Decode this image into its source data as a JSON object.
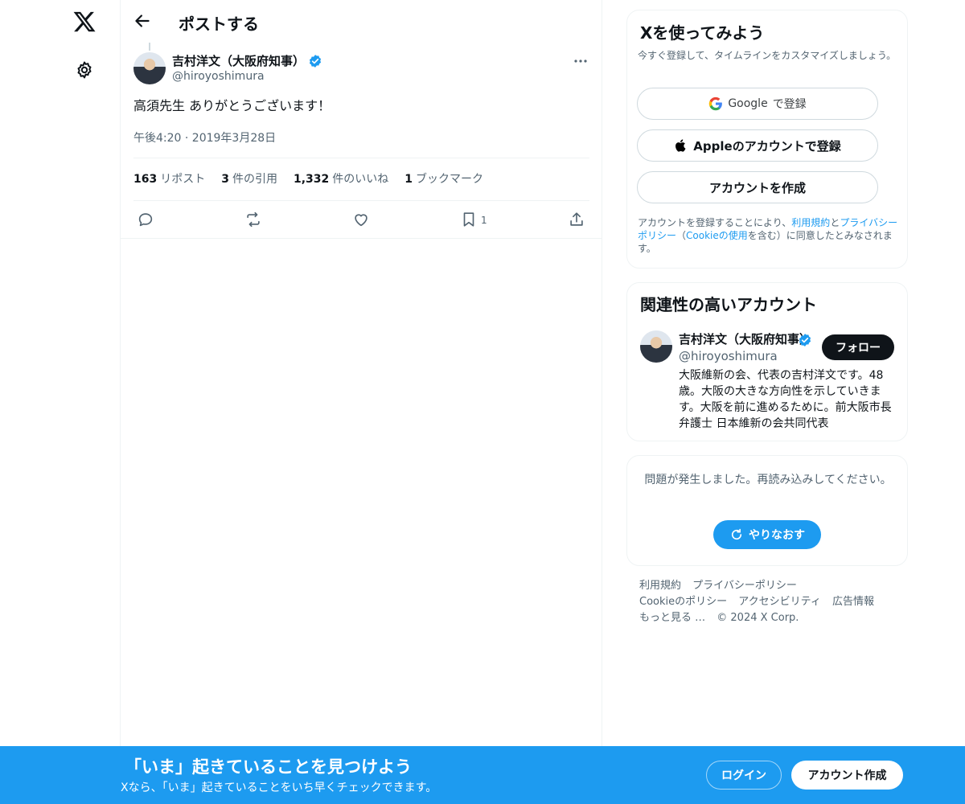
{
  "header": {
    "title": "ポストする"
  },
  "post": {
    "author_name": "吉村洋文（大阪府知事）",
    "author_handle": "@hiroyoshimura",
    "text": "高須先生 ありがとうございます！",
    "timestamp": "午後4:20 · 2019年3月28日",
    "stats": [
      {
        "count": "163",
        "label": "リポスト"
      },
      {
        "count": "3",
        "label": "件の引用"
      },
      {
        "count": "1,332",
        "label": "件のいいね"
      },
      {
        "count": "1",
        "label": "ブックマーク"
      }
    ],
    "bookmark_count": "1"
  },
  "signup_card": {
    "title": "Xを使ってみよう",
    "subtitle": "今すぐ登録して、タイムラインをカスタマイズしましょう。",
    "google_label": "Google",
    "google_suffix": "で登録",
    "apple_label": "Appleのアカウントで登録",
    "create_label": "アカウントを作成",
    "legal_prefix": "アカウントを登録することにより、",
    "legal_terms": "利用規約",
    "legal_and": "と",
    "legal_privacy": "プライバシーポリシー",
    "legal_open": "（",
    "legal_cookie": "Cookieの使用",
    "legal_suffix": "を含む）に同意したとみなされます。"
  },
  "related_card": {
    "title": "関連性の高いアカウント",
    "name": "吉村洋文（大阪府知事）",
    "handle": "@hiroyoshimura",
    "follow_label": "フォロー",
    "bio": "大阪維新の会、代表の吉村洋文です。48歳。大阪の大きな方向性を示していきます。大阪を前に進めるために。前大阪市長 弁護士 日本維新の会共同代表"
  },
  "error_card": {
    "message": "問題が発生しました。再読み込みしてください。",
    "retry_label": "やりなおす"
  },
  "footer": {
    "terms": "利用規約",
    "privacy": "プライバシーポリシー",
    "cookie": "Cookieのポリシー",
    "accessibility": "アクセシビリティ",
    "ads": "広告情報",
    "more": "もっと見る …",
    "copyright": "© 2024 X Corp."
  },
  "banner": {
    "title": "「いま」起きていることを見つけよう",
    "subtitle": "Xなら、「いま」起きていることをいち早くチェックできます。",
    "login_label": "ログイン",
    "signup_label": "アカウント作成"
  },
  "colors": {
    "accent": "#1d9bf0",
    "text": "#0f1419",
    "muted": "#536471",
    "border": "#eff3f4"
  }
}
